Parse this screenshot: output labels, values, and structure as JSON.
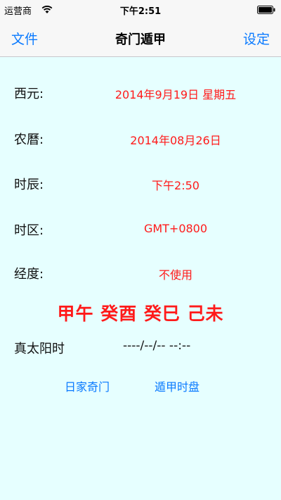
{
  "status_bar": {
    "carrier": "运营商",
    "time": "下午2:51"
  },
  "nav": {
    "left_button": "文件",
    "title": "奇门遁甲",
    "right_button": "设定"
  },
  "rows": [
    {
      "label": "西元:",
      "value": "2014年9月19日 星期五"
    },
    {
      "label": "农曆:",
      "value": "2014年08月26日"
    },
    {
      "label": "时辰:",
      "value": "下午2:50"
    },
    {
      "label": "时区:",
      "value": "GMT+0800"
    },
    {
      "label": "经度:",
      "value": "不使用"
    }
  ],
  "ganzhi": "甲午 癸酉 癸巳 己未",
  "true_solar": {
    "label": "真太阳时",
    "value": "----/--/-- --:--"
  },
  "links": {
    "left": "日家奇门",
    "right": "遁甲时盘"
  },
  "colors": {
    "accent": "#0a7aff",
    "value_red": "#ff1a1a",
    "content_bg": "#e6ffff"
  }
}
